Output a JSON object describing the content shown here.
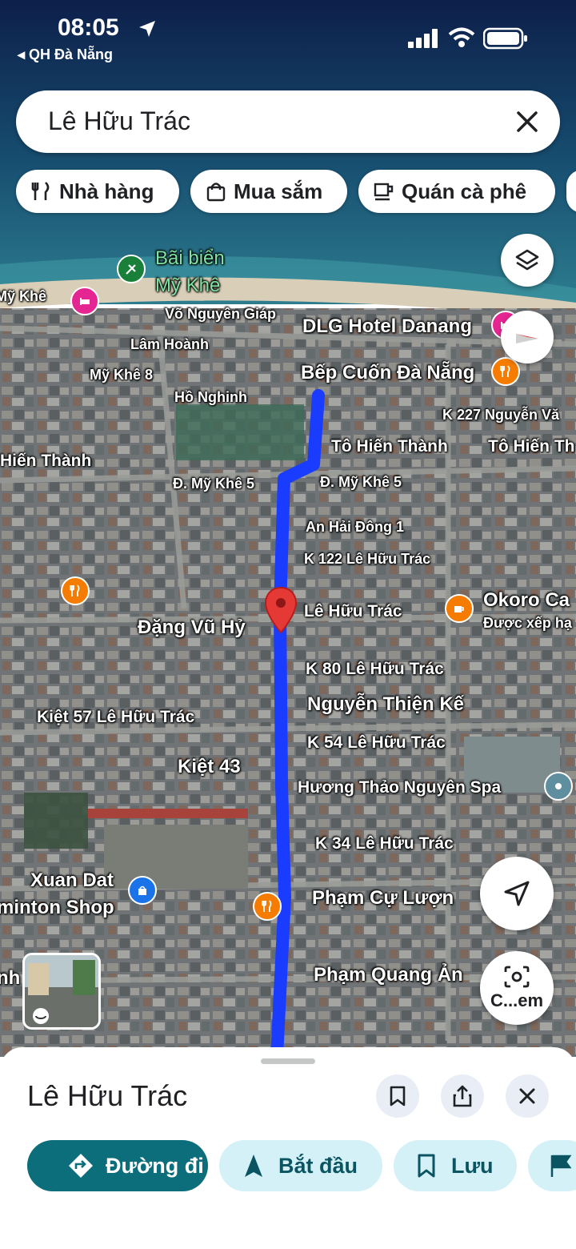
{
  "status_bar": {
    "time": "08:05",
    "back_app": "◂ QH Đà Nẵng"
  },
  "search": {
    "query": "Lê Hữu Trác"
  },
  "chips": [
    {
      "icon": "restaurant-icon",
      "label": "Nhà hàng"
    },
    {
      "icon": "shopping-bag-icon",
      "label": "Mua sắm"
    },
    {
      "icon": "coffee-cup-icon",
      "label": "Quán cà phê"
    }
  ],
  "map": {
    "beach_name": "Bãi biển Mỹ Khê",
    "labels": {
      "my_khe": "Mỹ Khê",
      "vo_nguyen_giap": "Võ Nguyên Giáp",
      "lam_hoanh": "Lâm Hoành",
      "my_khe_8": "Mỹ Khê 8",
      "ho_nghinh": "Hồ Nghinh",
      "hien_thanh": "Hiến Thành",
      "dlg_hotel": "DLG Hotel Danang",
      "bep_cuon": "Bếp Cuốn Đà Nẵng",
      "k227": "K 227 Nguyễn Vă",
      "to_hien_thanh_1": "Tô Hiến Thành",
      "to_hien_thanh_2": "Tô Hiến Th",
      "my_khe_5_left": "Đ. Mỹ Khê 5",
      "my_khe_5_right": "Đ. Mỹ Khê 5",
      "an_hai_dong": "An Hải Đông 1",
      "k122": "K 122 Lê Hữu Trác",
      "le_huu_trac": "Lê Hữu Trác",
      "okoro": "Okoro Ca",
      "okoro_sub": "Được xếp hạ",
      "dang_vu_hy": "Đặng Vũ Hỷ",
      "k80": "K 80 Lê Hữu Trác",
      "nguyen_thien_ke": "Nguyễn Thiện Kế",
      "kiet57": "Kiệt 57 Lê Hữu Trác",
      "k54": "K 54 Lê Hữu Trác",
      "kiet43": "Kiệt 43",
      "huong_thao": "Hương Thảo Nguyên Spa",
      "k34": "K 34 Lê Hữu Trác",
      "xuan_dat": "Xuan Dat",
      "minton_shop": "minton Shop",
      "pham_cu_luong": "Phạm Cự Lượn",
      "pham_quang_anh": "Phạm Quang Ản",
      "nh": "nh"
    },
    "lens_label": "C...em",
    "route_color": "#1a3cff",
    "pin_color": "#e53935"
  },
  "sheet": {
    "title": "Lê Hữu Trác",
    "actions": [
      {
        "icon": "directions-icon",
        "label": "Đường đi"
      },
      {
        "icon": "navigation-arrow-icon",
        "label": "Bắt đầu"
      },
      {
        "icon": "bookmark-icon",
        "label": "Lưu"
      }
    ]
  },
  "colors": {
    "primary": "#0b6e7a",
    "tonal": "#d3f1f7",
    "tonal_text": "#0b5563"
  }
}
